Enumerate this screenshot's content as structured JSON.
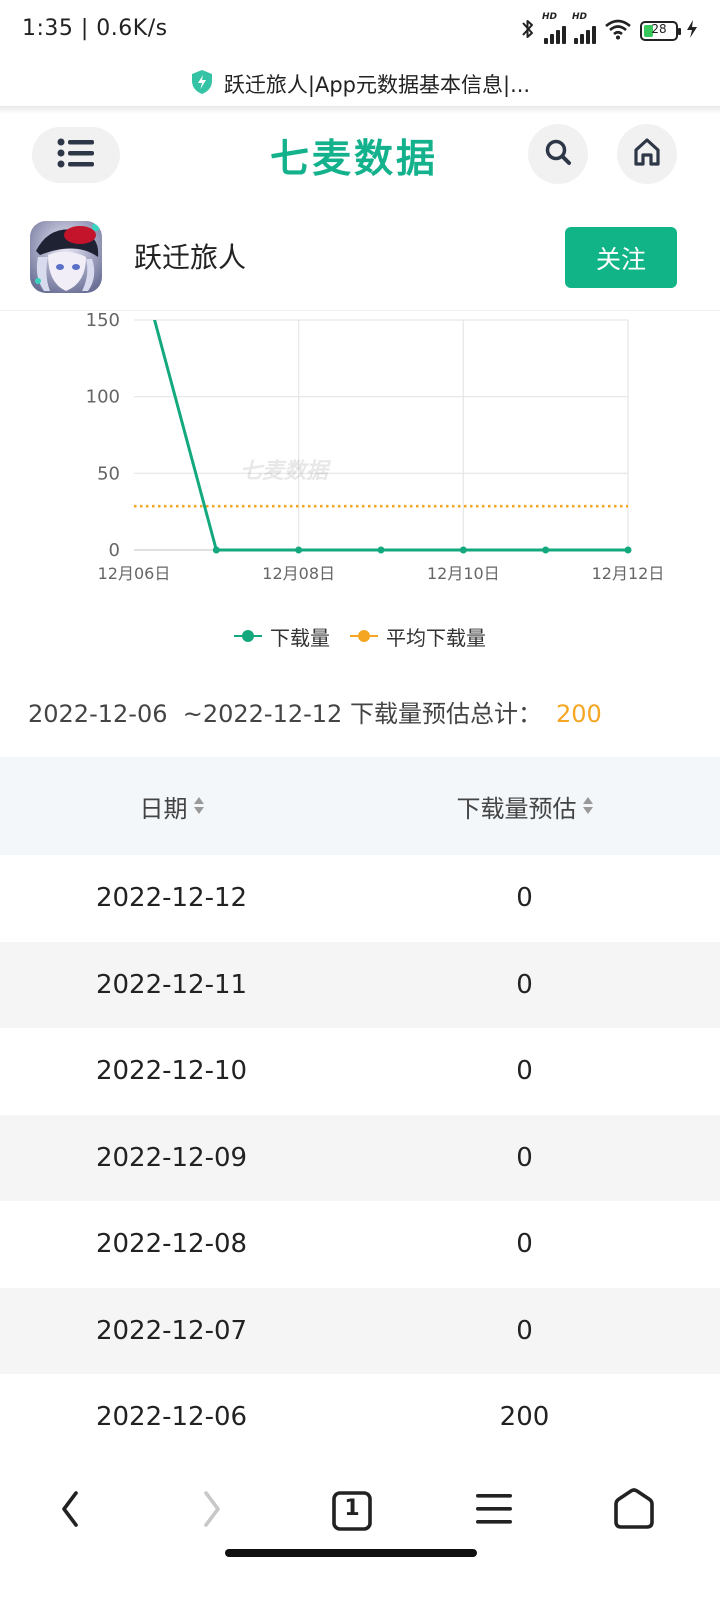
{
  "status_bar": {
    "time": "1:35 | 0.6K/s",
    "battery": "28",
    "icons": [
      "bluetooth-icon",
      "hd-signal-icon",
      "hd-signal-icon",
      "wifi-icon",
      "battery-icon",
      "charging-icon"
    ]
  },
  "browser": {
    "url_title": "跃迁旅人|App元数据基本信息|..."
  },
  "header": {
    "logo": "七麦数据",
    "icons": [
      "menu-icon",
      "search-icon",
      "home-icon"
    ]
  },
  "app": {
    "name": "跃迁旅人",
    "follow_label": "关注"
  },
  "chart_data": {
    "type": "line",
    "x": [
      "12月06日",
      "12月07日",
      "12月08日",
      "12月09日",
      "12月10日",
      "12月11日",
      "12月12日"
    ],
    "xtick_labels": [
      "12月06日",
      "12月08日",
      "12月10日",
      "12月12日"
    ],
    "series": [
      {
        "name": "下载量",
        "values": [
          200,
          0,
          0,
          0,
          0,
          0,
          0
        ],
        "color": "#14a87f"
      },
      {
        "name": "平均下载量",
        "values": [
          28.6,
          28.6,
          28.6,
          28.6,
          28.6,
          28.6,
          28.6
        ],
        "color": "#f5a623",
        "style": "dotted"
      }
    ],
    "ylim": [
      0,
      150
    ],
    "yticks": [
      "0",
      "50",
      "100",
      "150"
    ],
    "watermark": "七麦数据",
    "grid": true,
    "legend_position": "bottom"
  },
  "summary": {
    "range_label": "2022-12-06  ~2022-12-12 下载量预估总计：",
    "total": "200"
  },
  "table": {
    "columns": [
      "日期",
      "下载量预估"
    ],
    "rows": [
      {
        "date": "2022-12-12",
        "value": "0"
      },
      {
        "date": "2022-12-11",
        "value": "0"
      },
      {
        "date": "2022-12-10",
        "value": "0"
      },
      {
        "date": "2022-12-09",
        "value": "0"
      },
      {
        "date": "2022-12-08",
        "value": "0"
      },
      {
        "date": "2022-12-07",
        "value": "0"
      },
      {
        "date": "2022-12-06",
        "value": "200"
      }
    ]
  },
  "bottom_nav": {
    "tab_count": "1",
    "icons": [
      "back-icon",
      "forward-icon",
      "tabs-icon",
      "menu-icon",
      "home-icon"
    ]
  },
  "colors": {
    "brand": "#14b28c",
    "follow_button": "#10b486",
    "series_download": "#14a87f",
    "series_average": "#f5a623",
    "summary_total": "#f5a623"
  }
}
